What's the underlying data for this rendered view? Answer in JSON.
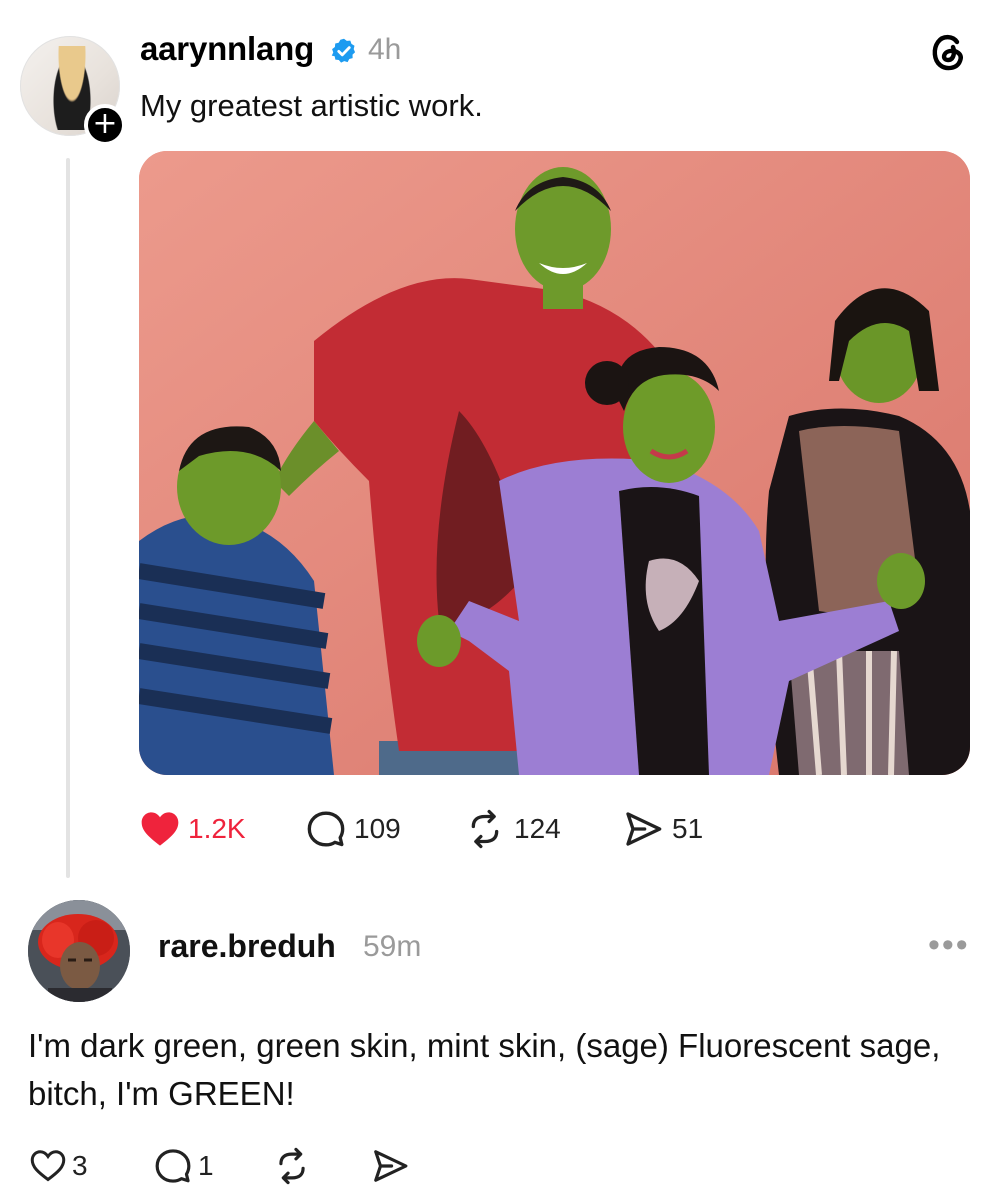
{
  "post": {
    "username": "aarynnlang",
    "time": "4h",
    "caption": "My greatest artistic work.",
    "stats": {
      "likes": "1.2K",
      "replies": "109",
      "reposts": "124",
      "shares": "51"
    },
    "icons": {
      "avatar": "profile-avatar",
      "follow": "plus-icon",
      "verified": "verified-badge-icon",
      "app": "threads-logo-icon",
      "like": "heart-filled-icon",
      "reply": "speech-bubble-icon",
      "repost": "repost-arrows-icon",
      "share": "send-arrow-icon"
    },
    "colors": {
      "like": "#ef233c",
      "verified": "#1d9bf0"
    }
  },
  "reply": {
    "username": "rare.breduh",
    "time": "59m",
    "text": "I'm dark green, green skin, mint skin, (sage) Fluorescent sage, bitch, I'm GREEN!",
    "stats": {
      "likes": "3",
      "replies": "1"
    },
    "more": "•••"
  }
}
